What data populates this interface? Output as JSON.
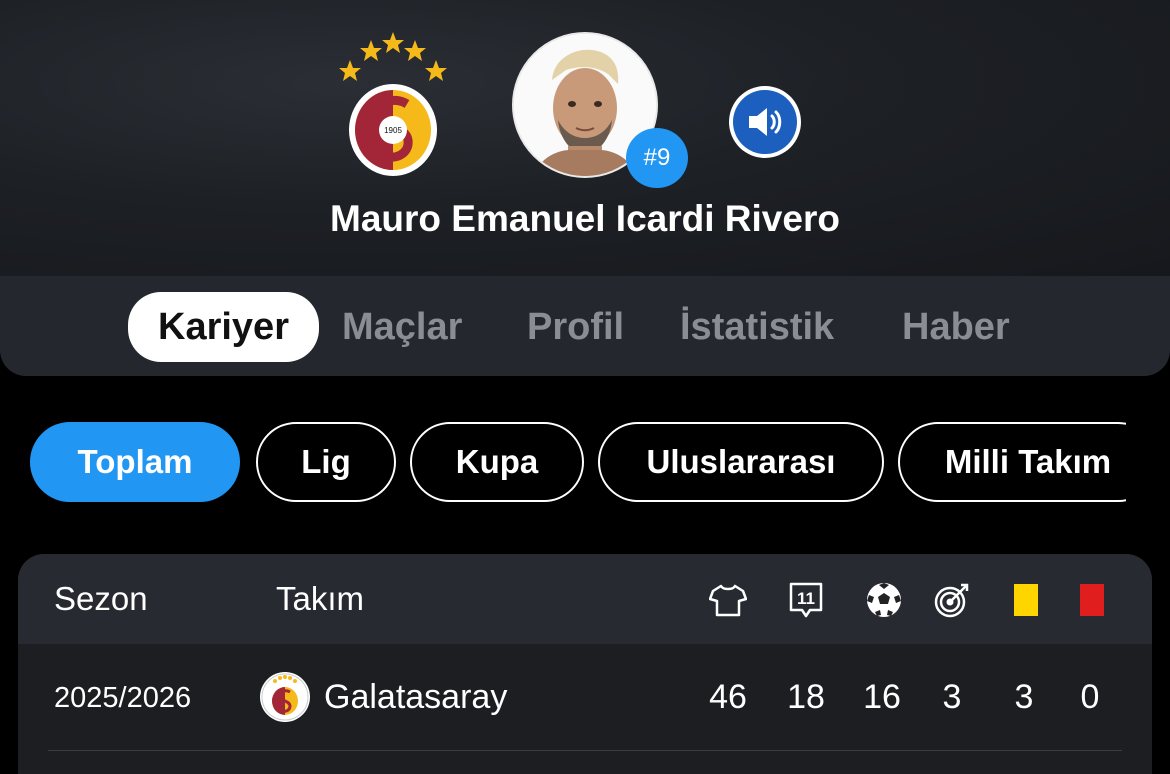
{
  "player": {
    "name": "Mauro Emanuel Icardi Rivero",
    "number": "#9",
    "club_logo_year": "1905"
  },
  "colors": {
    "accent": "#2196f3",
    "club_red": "#a32638",
    "club_yellow": "#fdb912",
    "audio_blue": "#1d5fbf"
  },
  "tabs": [
    {
      "label": "Kariyer",
      "active": true
    },
    {
      "label": "Maçlar",
      "active": false
    },
    {
      "label": "Profil",
      "active": false
    },
    {
      "label": "İstatistik",
      "active": false
    },
    {
      "label": "Haber",
      "active": false
    }
  ],
  "filters": [
    {
      "label": "Toplam",
      "active": true
    },
    {
      "label": "Lig",
      "active": false
    },
    {
      "label": "Kupa",
      "active": false
    },
    {
      "label": "Uluslararası",
      "active": false
    },
    {
      "label": "Milli Takım",
      "active": false
    }
  ],
  "table": {
    "headers": {
      "season": "Sezon",
      "team": "Takım",
      "icons": [
        "shirt-icon",
        "lineup-11-icon",
        "football-icon",
        "assist-target-icon",
        "yellow-card-icon",
        "red-card-icon"
      ],
      "lineup_number": "11"
    },
    "rows": [
      {
        "season": "2025/2026",
        "team": "Galatasaray",
        "stats": [
          "46",
          "18",
          "16",
          "3",
          "3",
          "0"
        ]
      }
    ]
  }
}
